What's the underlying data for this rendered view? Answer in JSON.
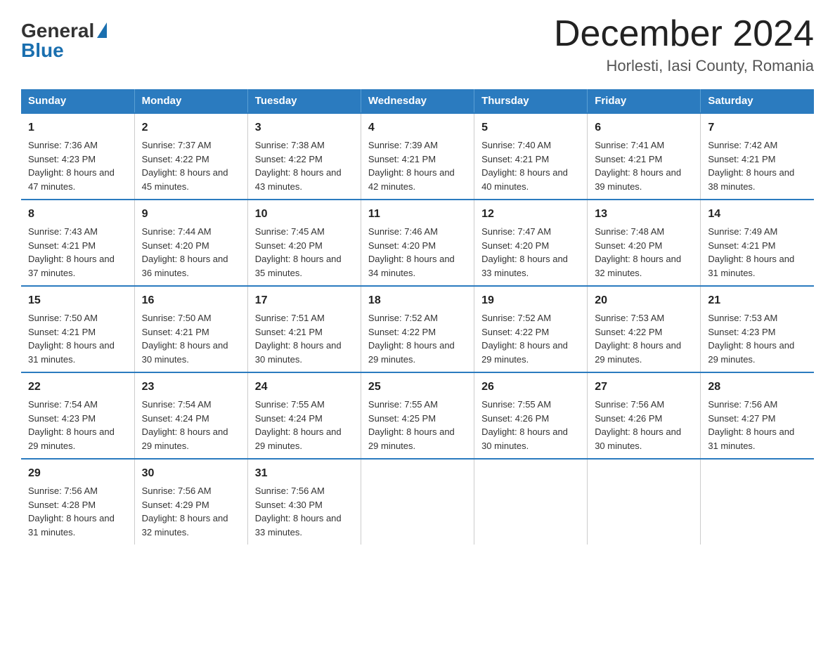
{
  "logo": {
    "general": "General",
    "blue": "Blue"
  },
  "title": "December 2024",
  "subtitle": "Horlesti, Iasi County, Romania",
  "days_of_week": [
    "Sunday",
    "Monday",
    "Tuesday",
    "Wednesday",
    "Thursday",
    "Friday",
    "Saturday"
  ],
  "weeks": [
    [
      {
        "day": "1",
        "sunrise": "7:36 AM",
        "sunset": "4:23 PM",
        "daylight": "8 hours and 47 minutes."
      },
      {
        "day": "2",
        "sunrise": "7:37 AM",
        "sunset": "4:22 PM",
        "daylight": "8 hours and 45 minutes."
      },
      {
        "day": "3",
        "sunrise": "7:38 AM",
        "sunset": "4:22 PM",
        "daylight": "8 hours and 43 minutes."
      },
      {
        "day": "4",
        "sunrise": "7:39 AM",
        "sunset": "4:21 PM",
        "daylight": "8 hours and 42 minutes."
      },
      {
        "day": "5",
        "sunrise": "7:40 AM",
        "sunset": "4:21 PM",
        "daylight": "8 hours and 40 minutes."
      },
      {
        "day": "6",
        "sunrise": "7:41 AM",
        "sunset": "4:21 PM",
        "daylight": "8 hours and 39 minutes."
      },
      {
        "day": "7",
        "sunrise": "7:42 AM",
        "sunset": "4:21 PM",
        "daylight": "8 hours and 38 minutes."
      }
    ],
    [
      {
        "day": "8",
        "sunrise": "7:43 AM",
        "sunset": "4:21 PM",
        "daylight": "8 hours and 37 minutes."
      },
      {
        "day": "9",
        "sunrise": "7:44 AM",
        "sunset": "4:20 PM",
        "daylight": "8 hours and 36 minutes."
      },
      {
        "day": "10",
        "sunrise": "7:45 AM",
        "sunset": "4:20 PM",
        "daylight": "8 hours and 35 minutes."
      },
      {
        "day": "11",
        "sunrise": "7:46 AM",
        "sunset": "4:20 PM",
        "daylight": "8 hours and 34 minutes."
      },
      {
        "day": "12",
        "sunrise": "7:47 AM",
        "sunset": "4:20 PM",
        "daylight": "8 hours and 33 minutes."
      },
      {
        "day": "13",
        "sunrise": "7:48 AM",
        "sunset": "4:20 PM",
        "daylight": "8 hours and 32 minutes."
      },
      {
        "day": "14",
        "sunrise": "7:49 AM",
        "sunset": "4:21 PM",
        "daylight": "8 hours and 31 minutes."
      }
    ],
    [
      {
        "day": "15",
        "sunrise": "7:50 AM",
        "sunset": "4:21 PM",
        "daylight": "8 hours and 31 minutes."
      },
      {
        "day": "16",
        "sunrise": "7:50 AM",
        "sunset": "4:21 PM",
        "daylight": "8 hours and 30 minutes."
      },
      {
        "day": "17",
        "sunrise": "7:51 AM",
        "sunset": "4:21 PM",
        "daylight": "8 hours and 30 minutes."
      },
      {
        "day": "18",
        "sunrise": "7:52 AM",
        "sunset": "4:22 PM",
        "daylight": "8 hours and 29 minutes."
      },
      {
        "day": "19",
        "sunrise": "7:52 AM",
        "sunset": "4:22 PM",
        "daylight": "8 hours and 29 minutes."
      },
      {
        "day": "20",
        "sunrise": "7:53 AM",
        "sunset": "4:22 PM",
        "daylight": "8 hours and 29 minutes."
      },
      {
        "day": "21",
        "sunrise": "7:53 AM",
        "sunset": "4:23 PM",
        "daylight": "8 hours and 29 minutes."
      }
    ],
    [
      {
        "day": "22",
        "sunrise": "7:54 AM",
        "sunset": "4:23 PM",
        "daylight": "8 hours and 29 minutes."
      },
      {
        "day": "23",
        "sunrise": "7:54 AM",
        "sunset": "4:24 PM",
        "daylight": "8 hours and 29 minutes."
      },
      {
        "day": "24",
        "sunrise": "7:55 AM",
        "sunset": "4:24 PM",
        "daylight": "8 hours and 29 minutes."
      },
      {
        "day": "25",
        "sunrise": "7:55 AM",
        "sunset": "4:25 PM",
        "daylight": "8 hours and 29 minutes."
      },
      {
        "day": "26",
        "sunrise": "7:55 AM",
        "sunset": "4:26 PM",
        "daylight": "8 hours and 30 minutes."
      },
      {
        "day": "27",
        "sunrise": "7:56 AM",
        "sunset": "4:26 PM",
        "daylight": "8 hours and 30 minutes."
      },
      {
        "day": "28",
        "sunrise": "7:56 AM",
        "sunset": "4:27 PM",
        "daylight": "8 hours and 31 minutes."
      }
    ],
    [
      {
        "day": "29",
        "sunrise": "7:56 AM",
        "sunset": "4:28 PM",
        "daylight": "8 hours and 31 minutes."
      },
      {
        "day": "30",
        "sunrise": "7:56 AM",
        "sunset": "4:29 PM",
        "daylight": "8 hours and 32 minutes."
      },
      {
        "day": "31",
        "sunrise": "7:56 AM",
        "sunset": "4:30 PM",
        "daylight": "8 hours and 33 minutes."
      },
      null,
      null,
      null,
      null
    ]
  ],
  "labels": {
    "sunrise": "Sunrise:",
    "sunset": "Sunset:",
    "daylight": "Daylight:"
  }
}
